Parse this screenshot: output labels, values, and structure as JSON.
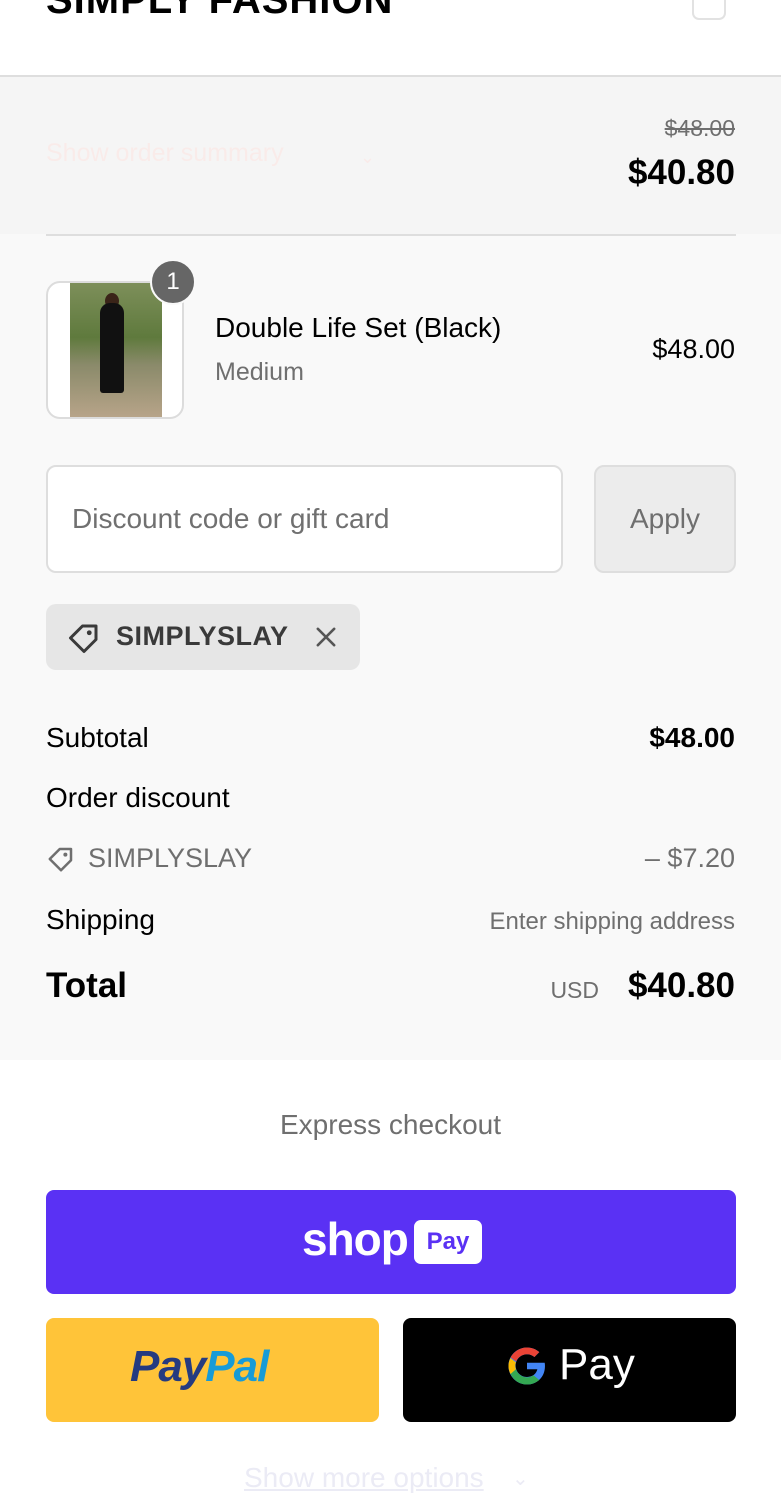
{
  "header": {
    "brand": "SIMPLY FASHION",
    "cart_icon": "bag-icon"
  },
  "summary_toggle": {
    "label": "Show order summary",
    "chevron_icon": "chevron-down-icon",
    "compare_price": "$48.00",
    "total": "$40.80"
  },
  "line_item": {
    "quantity": "1",
    "name": "Double Life Set (Black)",
    "variant": "Medium",
    "price": "$48.00"
  },
  "discount": {
    "placeholder": "Discount code or gift card",
    "value": "",
    "apply_label": "Apply",
    "applied_code": "SIMPLYSLAY",
    "tag_icon": "tag-icon",
    "remove_icon": "close-icon"
  },
  "totals": {
    "subtotal_label": "Subtotal",
    "subtotal_value": "$48.00",
    "order_discount_label": "Order discount",
    "discount_code": "SIMPLYSLAY",
    "discount_value": "– $7.20",
    "shipping_label": "Shipping",
    "shipping_value": "Enter shipping address",
    "total_label": "Total",
    "currency": "USD",
    "total_value": "$40.80"
  },
  "express": {
    "title": "Express checkout",
    "shop_pay": {
      "word": "shop",
      "badge": "Pay",
      "color": "#5a31f4"
    },
    "paypal": {
      "part1": "Pay",
      "part2": "Pal",
      "color": "#ffc439"
    },
    "google_pay": {
      "word": "Pay",
      "icon": "google-g-icon",
      "color": "#000000"
    },
    "more_options": "Show more options"
  }
}
